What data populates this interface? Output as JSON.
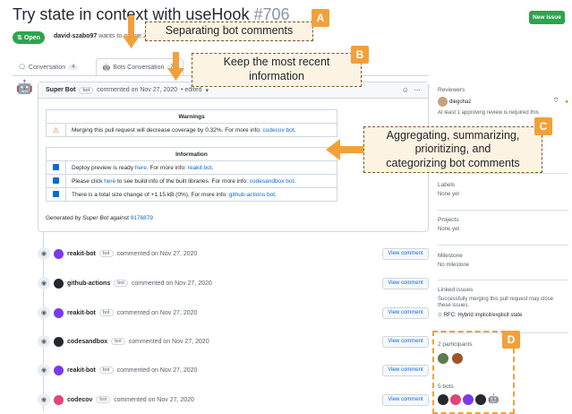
{
  "header": {
    "title": "Try state in context with useHook",
    "issue_number": "#706",
    "new_issue_label": "New issue",
    "state": "Open",
    "author": "david-szabo97",
    "subline_text": "wants to merge 25"
  },
  "tabs": [
    {
      "label": "Conversation",
      "count": "4"
    },
    {
      "label": "Bots Conversation",
      "count": "7"
    }
  ],
  "super_comment": {
    "author": "Super Bot",
    "bot_label": "bot",
    "meta": "commented on Nov 27, 2020",
    "edited": "• edited",
    "warnings_header": "Warnings",
    "warning_text": "Merging this pull request will decrease coverage by 0.32%. For more info:",
    "warning_link": "codecov bot",
    "information_header": "Information",
    "info_rows": [
      {
        "text": "Deploy preview is ready",
        "link1": "here",
        "mid": ". For more info:",
        "link2": "reakit bot"
      },
      {
        "text": "Please click",
        "link1": "here",
        "mid": "to see build info of the built libraries. For more info:",
        "link2": "codesandbox bot"
      },
      {
        "text": "There is a total size change of +1.15 kB (0%). For more info:",
        "link1": "",
        "mid": "",
        "link2": "github-actions bot"
      }
    ],
    "generated_prefix": "Generated by",
    "generated_by": "Super Bot",
    "generated_against": "against",
    "commit": "9176879"
  },
  "timeline": [
    {
      "name": "reakit-bot",
      "color": "#7c3aed"
    },
    {
      "name": "github-actions",
      "color": "#24292f"
    },
    {
      "name": "reakit-bot",
      "color": "#7c3aed"
    },
    {
      "name": "codesandbox",
      "color": "#24292f"
    },
    {
      "name": "reakit-bot",
      "color": "#7c3aed"
    },
    {
      "name": "codecov",
      "color": "#e0457b"
    }
  ],
  "timeline_common": {
    "bot_label": "bot",
    "meta": "commented on Nov 27, 2020",
    "view_label": "View comment"
  },
  "sidebar": {
    "reviewers_h": "Reviewers",
    "reviewer": "diegohaz",
    "reviewer_note": "At least 1 approving review is required",
    "reviewer_note_end": "this",
    "labels_h": "Labels",
    "labels_v": "None yet",
    "projects_h": "Projects",
    "projects_v": "None yet",
    "milestone_h": "Milestone",
    "milestone_v": "No milestone",
    "linked_h": "Linked issues",
    "linked_v1": "Successfully merging this pull request may close",
    "linked_v2": "these issues.",
    "linked_issue": "RFC: Hybrid implicit/explicit state",
    "participants_h": "2 participants",
    "bots_h": "5 bots"
  },
  "annotations": {
    "a_text": "Separating bot comments",
    "a_tag": "A",
    "b_text1": "Keep the most recent",
    "b_text2": "information",
    "b_tag": "B",
    "c_text1": "Aggregating, summarizing,",
    "c_text2": "prioritizing, and",
    "c_text3": "categorizing bot comments",
    "c_tag": "C",
    "d_tag": "D"
  },
  "colors": {
    "accent": "#f3a03a",
    "open_green": "#2da44e",
    "link_blue": "#0969da"
  }
}
